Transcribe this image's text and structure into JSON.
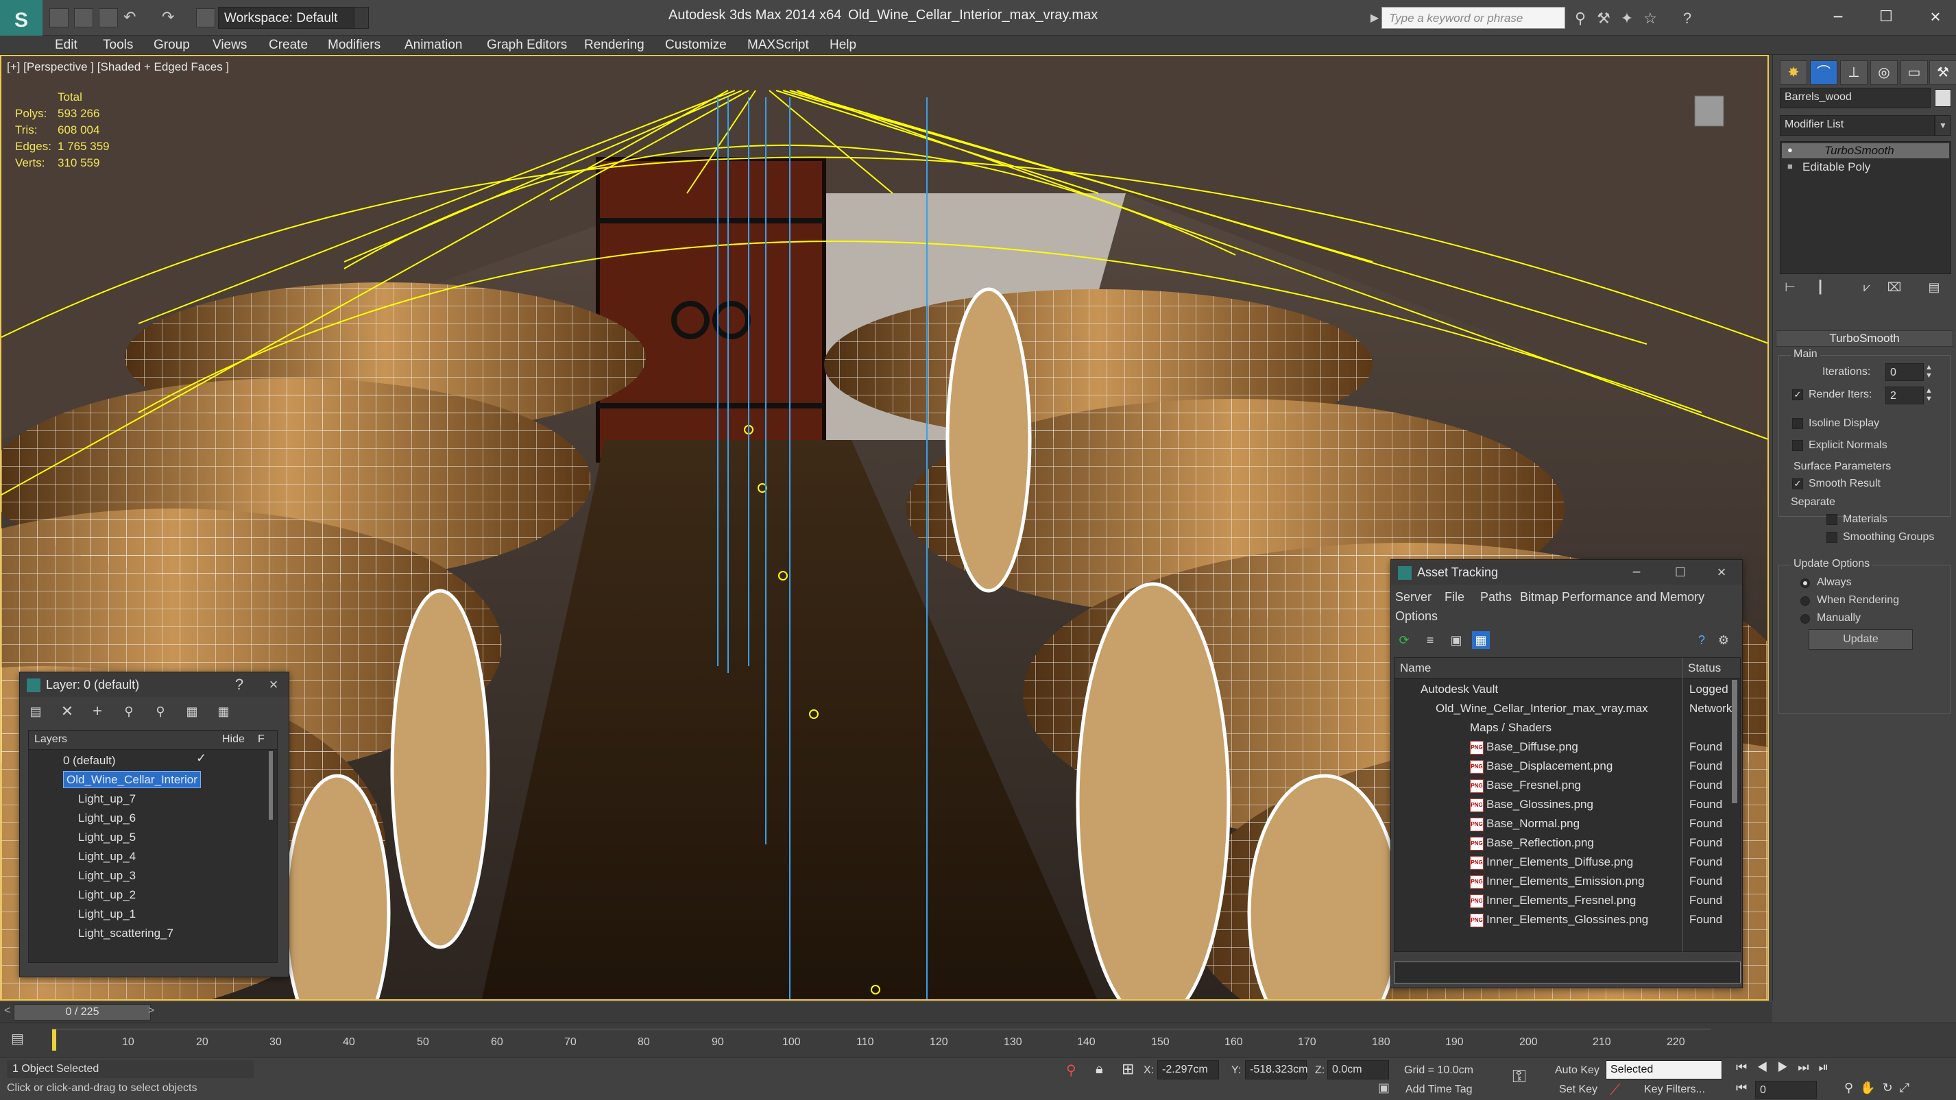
{
  "titlebar": {
    "workspace": "Workspace: Default",
    "app_title": "Autodesk 3ds Max  2014 x64",
    "doc_title": "Old_Wine_Cellar_Interior_max_vray.max",
    "search_placeholder": "Type a keyword or phrase"
  },
  "menu": [
    "Edit",
    "Tools",
    "Group",
    "Views",
    "Create",
    "Modifiers",
    "Animation",
    "Graph Editors",
    "Rendering",
    "Customize",
    "MAXScript",
    "Help"
  ],
  "viewport": {
    "label": "[+] [Perspective ] [Shaded + Edged Faces ]",
    "stats_title": "Total",
    "stats": [
      {
        "label": "Polys:",
        "value": "593 266"
      },
      {
        "label": "Tris:",
        "value": "608 004"
      },
      {
        "label": "Edges:",
        "value": "1 765 359"
      },
      {
        "label": "Verts:",
        "value": "310 559"
      }
    ]
  },
  "command_panel": {
    "object_name": "Barrels_wood",
    "modifier_list": "Modifier List",
    "stack": [
      "TurboSmooth",
      "Editable Poly"
    ],
    "rollout_title": "TurboSmooth",
    "main_label": "Main",
    "iterations_label": "Iterations:",
    "iterations_value": "0",
    "render_iters_label": "Render Iters:",
    "render_iters_value": "2",
    "isoline": "Isoline Display",
    "explicit": "Explicit Normals",
    "surface_params": "Surface Parameters",
    "smooth_result": "Smooth Result",
    "separate": "Separate",
    "materials": "Materials",
    "smoothing_groups": "Smoothing Groups",
    "update_options": "Update Options",
    "always": "Always",
    "when_rendering": "When Rendering",
    "manually": "Manually",
    "update_btn": "Update"
  },
  "layer_window": {
    "title": "Layer: 0 (default)",
    "help": "?",
    "col_layers": "Layers",
    "col_hide": "Hide",
    "col_f": "F",
    "rows": [
      "0 (default)",
      "Old_Wine_Cellar_Interior",
      "Light_up_7",
      "Light_up_6",
      "Light_up_5",
      "Light_up_4",
      "Light_up_3",
      "Light_up_2",
      "Light_up_1",
      "Light_scattering_7"
    ]
  },
  "asset_window": {
    "title": "Asset Tracking",
    "menu": [
      "Server",
      "File",
      "Paths",
      "Bitmap Performance and Memory",
      "Options"
    ],
    "col_name": "Name",
    "col_status": "Status",
    "rows": [
      {
        "name": "Autodesk Vault",
        "status": "Logged"
      },
      {
        "name": "Old_Wine_Cellar_Interior_max_vray.max",
        "status": "Network"
      },
      {
        "name": "Maps / Shaders",
        "status": ""
      },
      {
        "name": "Base_Diffuse.png",
        "status": "Found"
      },
      {
        "name": "Base_Displacement.png",
        "status": "Found"
      },
      {
        "name": "Base_Fresnel.png",
        "status": "Found"
      },
      {
        "name": "Base_Glossines.png",
        "status": "Found"
      },
      {
        "name": "Base_Normal.png",
        "status": "Found"
      },
      {
        "name": "Base_Reflection.png",
        "status": "Found"
      },
      {
        "name": "Inner_Elements_Diffuse.png",
        "status": "Found"
      },
      {
        "name": "Inner_Elements_Emission.png",
        "status": "Found"
      },
      {
        "name": "Inner_Elements_Fresnel.png",
        "status": "Found"
      },
      {
        "name": "Inner_Elements_Glossines.png",
        "status": "Found"
      }
    ]
  },
  "timeline": {
    "frame": "0 / 225",
    "ticks": [
      "10",
      "20",
      "30",
      "40",
      "50",
      "60",
      "70",
      "80",
      "90",
      "100",
      "110",
      "120",
      "130",
      "140",
      "150",
      "160",
      "170",
      "180",
      "190",
      "200",
      "210",
      "220"
    ]
  },
  "status": {
    "selected": "1 Object Selected",
    "hint": "Click or click-and-drag to select objects",
    "x_label": "X:",
    "x_value": "-2.297cm",
    "y_label": "Y:",
    "y_value": "-518.323cm",
    "z_label": "Z:",
    "z_value": "0.0cm",
    "grid": "Grid = 10.0cm",
    "auto_key": "Auto Key",
    "selected_dd": "Selected",
    "set_key": "Set Key",
    "key_filters": "Key Filters...",
    "add_time_tag": "Add Time Tag",
    "frame_field": "0"
  },
  "colors": {
    "accent": "#f2c84b",
    "wire": "#ffffff",
    "selection": "#ffff00",
    "teal": "#2d7f7a"
  }
}
